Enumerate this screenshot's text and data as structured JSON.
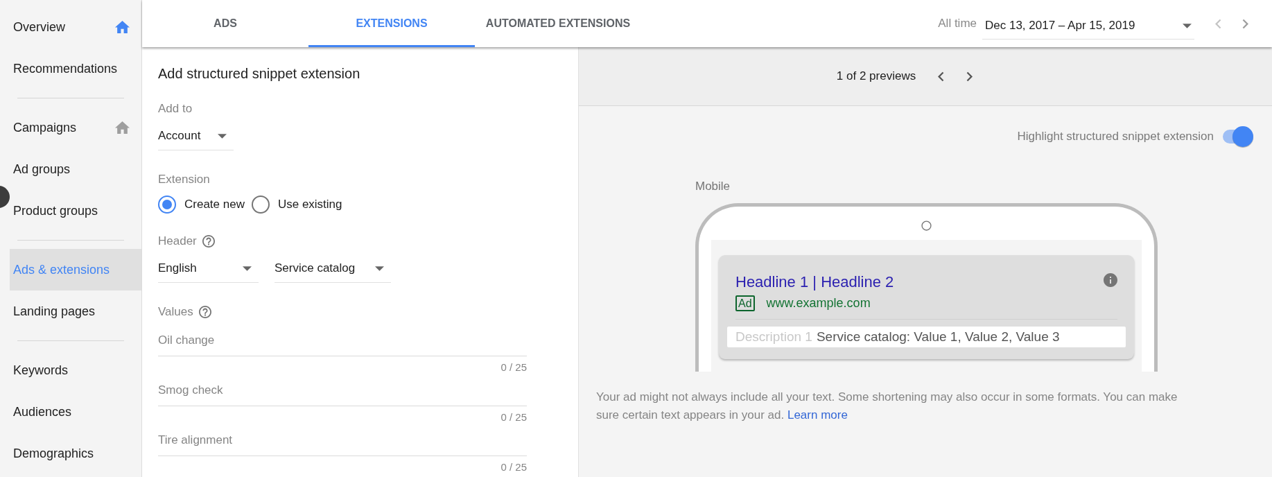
{
  "sidebar": {
    "groups": [
      [
        {
          "label": "Overview",
          "selected": false,
          "home_icon": {
            "highlighted": true
          }
        },
        {
          "label": "Recommendations",
          "selected": false
        }
      ],
      [
        {
          "label": "Campaigns",
          "selected": false,
          "home_icon": {
            "highlighted": false
          }
        },
        {
          "label": "Ad groups",
          "selected": false
        },
        {
          "label": "Product groups",
          "selected": false
        }
      ],
      [
        {
          "label": "Ads & extensions",
          "selected": true
        },
        {
          "label": "Landing pages",
          "selected": false
        }
      ],
      [
        {
          "label": "Keywords",
          "selected": false
        },
        {
          "label": "Audiences",
          "selected": false
        },
        {
          "label": "Demographics",
          "selected": false
        }
      ]
    ]
  },
  "tabs": [
    {
      "label": "ADS",
      "selected": false
    },
    {
      "label": "EXTENSIONS",
      "selected": true
    },
    {
      "label": "AUTOMATED EXTENSIONS",
      "selected": false
    }
  ],
  "date_range": {
    "label": "All time",
    "value": "Dec 13, 2017 – Apr 15, 2019"
  },
  "form": {
    "title": "Add structured snippet extension",
    "add_to": {
      "label": "Add to",
      "value": "Account"
    },
    "extension": {
      "label": "Extension",
      "options": [
        {
          "label": "Create new",
          "selected": true
        },
        {
          "label": "Use existing",
          "selected": false
        }
      ]
    },
    "header": {
      "label": "Header",
      "language": "English",
      "header_type": "Service catalog"
    },
    "values": {
      "label": "Values",
      "fields": [
        {
          "placeholder": "Oil change",
          "counter": "0 / 25"
        },
        {
          "placeholder": "Smog check",
          "counter": "0 / 25"
        },
        {
          "placeholder": "Tire alignment",
          "counter": "0 / 25"
        }
      ]
    }
  },
  "preview": {
    "pager": "1 of 2 previews",
    "highlight": {
      "label": "Highlight structured snippet extension",
      "on": true
    },
    "device_label": "Mobile",
    "ad": {
      "headline": "Headline 1 | Headline 2",
      "badge": "Ad",
      "url": "www.example.com",
      "description_placeholder": "Description 1",
      "snippet": "Service catalog: Value 1, Value 2, Value 3"
    },
    "note": "Your ad might not always include all your text. Some shortening may also occur in some formats. You can make sure certain text appears in your ad.",
    "note_link": "Learn more"
  }
}
